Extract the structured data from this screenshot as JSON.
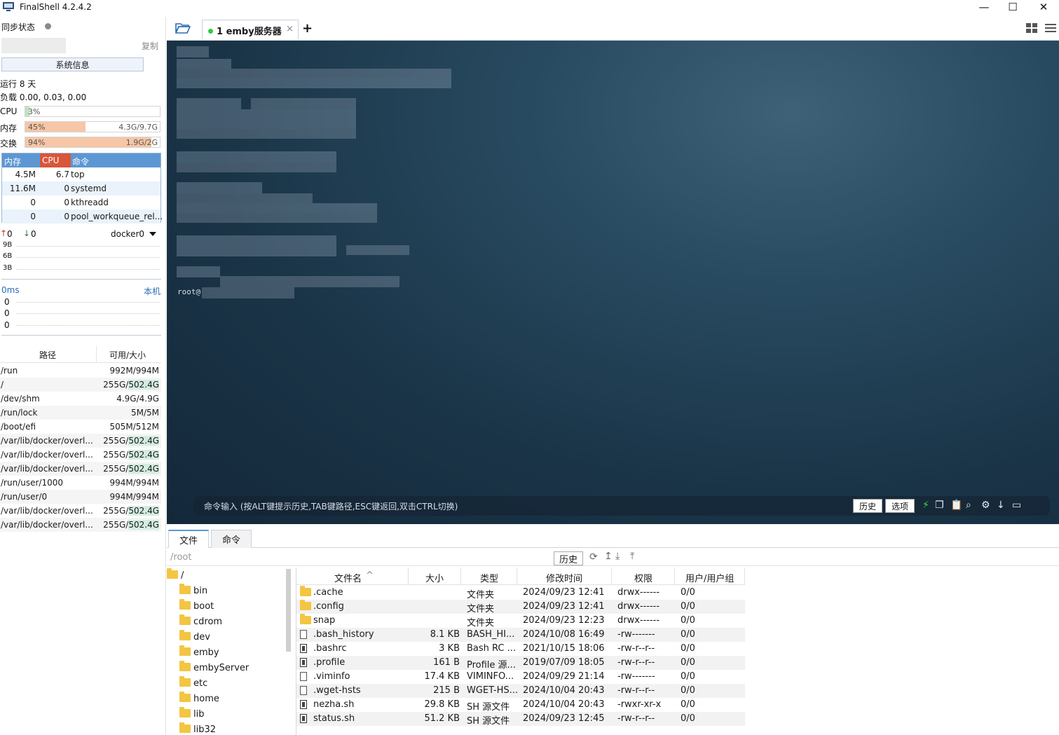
{
  "window": {
    "title": "FinalShell 4.2.4.2",
    "minimize": "—",
    "maximize": "☐",
    "close": "✕"
  },
  "sidebar": {
    "sync_label": "同步状态",
    "copy_label": "复制",
    "sysinfo_button": "系统信息",
    "uptime": "运行 8 天",
    "load": "负载 0.00, 0.03, 0.00",
    "cpu": {
      "label": "CPU",
      "percent_text": "3%",
      "percent": 3
    },
    "memory": {
      "label": "内存",
      "percent_text": "45%",
      "percent": 45,
      "amount": "4.3G/9.7G"
    },
    "swap": {
      "label": "交换",
      "percent_text": "94%",
      "percent": 94,
      "amount": "1.9G/2G"
    },
    "process_table": {
      "headers": [
        "内存",
        "CPU",
        "命令"
      ],
      "rows": [
        {
          "mem": "4.5M",
          "cpu": "6.7",
          "cmd": "top"
        },
        {
          "mem": "11.6M",
          "cpu": "0",
          "cmd": "systemd"
        },
        {
          "mem": "0",
          "cpu": "0",
          "cmd": "kthreadd"
        },
        {
          "mem": "0",
          "cpu": "0",
          "cmd": "pool_workqueue_rel..."
        }
      ]
    },
    "network": {
      "up": "0",
      "down": "0",
      "interface": "docker0",
      "scale": [
        "9B",
        "6B",
        "3B"
      ]
    },
    "latency": {
      "label": "0ms",
      "host": "本机",
      "values": [
        "0",
        "0",
        "0"
      ]
    },
    "filesystem": {
      "headers": [
        "路径",
        "可用/大小"
      ],
      "rows": [
        {
          "path": "/run",
          "avail": "992M/994M"
        },
        {
          "path": "/",
          "avail": "255G/",
          "size": "502.4G"
        },
        {
          "path": "/dev/shm",
          "avail": "4.9G/4.9G"
        },
        {
          "path": "/run/lock",
          "avail": "5M/5M"
        },
        {
          "path": "/boot/efi",
          "avail": "505M/512M"
        },
        {
          "path": "/var/lib/docker/overl...",
          "avail": "255G/",
          "size": "502.4G"
        },
        {
          "path": "/var/lib/docker/overl...",
          "avail": "255G/",
          "size": "502.4G"
        },
        {
          "path": "/var/lib/docker/overl...",
          "avail": "255G/",
          "size": "502.4G"
        },
        {
          "path": "/run/user/1000",
          "avail": "994M/994M"
        },
        {
          "path": "/run/user/0",
          "avail": "994M/994M"
        },
        {
          "path": "/var/lib/docker/overl...",
          "avail": "255G/",
          "size": "502.4G"
        },
        {
          "path": "/var/lib/docker/overl...",
          "avail": "255G/",
          "size": "502.4G"
        }
      ]
    }
  },
  "tabs": {
    "session_label": "1 emby服务器",
    "close": "×",
    "add": "+"
  },
  "terminal": {
    "prompt": "root@"
  },
  "command_bar": {
    "placeholder": "命令输入 (按ALT键提示历史,TAB键路径,ESC键返回,双击CTRL切换)",
    "history": "历史",
    "options": "选项"
  },
  "bottom": {
    "tabs": [
      "文件",
      "命令"
    ],
    "path": "/root",
    "history_button": "历史",
    "tree": [
      "/",
      "bin",
      "boot",
      "cdrom",
      "dev",
      "emby",
      "embyServer",
      "etc",
      "home",
      "lib",
      "lib32"
    ],
    "file_headers": [
      "文件名",
      "大小",
      "类型",
      "修改时间",
      "权限",
      "用户/用户组"
    ],
    "files": [
      {
        "name": ".cache",
        "size": "",
        "type": "文件夹",
        "mtime": "2024/09/23 12:41",
        "perm": "drwx------",
        "owner": "0/0",
        "kind": "folder"
      },
      {
        "name": ".config",
        "size": "",
        "type": "文件夹",
        "mtime": "2024/09/23 12:41",
        "perm": "drwx------",
        "owner": "0/0",
        "kind": "folder"
      },
      {
        "name": "snap",
        "size": "",
        "type": "文件夹",
        "mtime": "2024/09/23 12:23",
        "perm": "drwx------",
        "owner": "0/0",
        "kind": "folder"
      },
      {
        "name": ".bash_history",
        "size": "8.1 KB",
        "type": "BASH_HI...",
        "mtime": "2024/10/08 16:49",
        "perm": "-rw-------",
        "owner": "0/0",
        "kind": "doc"
      },
      {
        "name": ".bashrc",
        "size": "3 KB",
        "type": "Bash RC ...",
        "mtime": "2021/10/15 18:06",
        "perm": "-rw-r--r--",
        "owner": "0/0",
        "kind": "dark"
      },
      {
        "name": ".profile",
        "size": "161 B",
        "type": "Profile 源...",
        "mtime": "2019/07/09 18:05",
        "perm": "-rw-r--r--",
        "owner": "0/0",
        "kind": "dark"
      },
      {
        "name": ".viminfo",
        "size": "17.4 KB",
        "type": "VIMINFO...",
        "mtime": "2024/09/29 21:14",
        "perm": "-rw-------",
        "owner": "0/0",
        "kind": "doc"
      },
      {
        "name": ".wget-hsts",
        "size": "215 B",
        "type": "WGET-HS...",
        "mtime": "2024/10/04 20:43",
        "perm": "-rw-r--r--",
        "owner": "0/0",
        "kind": "doc"
      },
      {
        "name": "nezha.sh",
        "size": "29.8 KB",
        "type": "SH 源文件",
        "mtime": "2024/10/04 20:43",
        "perm": "-rwxr-xr-x",
        "owner": "0/0",
        "kind": "dark"
      },
      {
        "name": "status.sh",
        "size": "51.2 KB",
        "type": "SH 源文件",
        "mtime": "2024/09/23 12:45",
        "perm": "-rw-r--r--",
        "owner": "0/0",
        "kind": "dark"
      }
    ]
  },
  "colors": {
    "accent": "#5d97d3",
    "mem_fill": "#f6c6a6",
    "cpu_fill": "#cfe8cf",
    "terminal_bg": "#1f3a4f",
    "cpu_header": "#d9563a"
  }
}
